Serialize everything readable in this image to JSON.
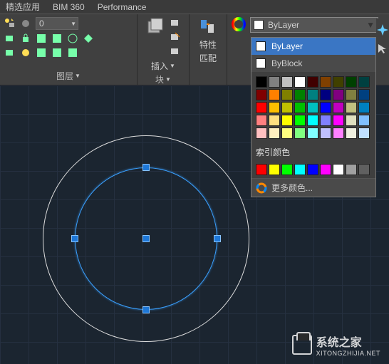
{
  "tabs": {
    "t1": "精选应用",
    "t2": "BIM 360",
    "t3": "Performance"
  },
  "panels": {
    "layers": {
      "label": "图层",
      "dropdown_value": "0"
    },
    "blocks": {
      "label": "块",
      "insert": "插入"
    },
    "props": {
      "label": "特性",
      "match": "匹配"
    }
  },
  "color_selector": {
    "current": "ByLayer"
  },
  "color_dropdown": {
    "bylayer": "ByLayer",
    "byblock": "ByBlock",
    "index_label": "索引颜色",
    "more": "更多颜色...",
    "palette": [
      "#000000",
      "#808080",
      "#c0c0c0",
      "#ffffff",
      "#400000",
      "#804000",
      "#404000",
      "#004000",
      "#004040",
      "#800000",
      "#ff8000",
      "#808000",
      "#008000",
      "#008080",
      "#000080",
      "#800080",
      "#808040",
      "#004080",
      "#ff0000",
      "#ffc000",
      "#c0c000",
      "#00c000",
      "#00c0c0",
      "#0000ff",
      "#c000c0",
      "#c0c080",
      "#0080c0",
      "#ff8080",
      "#ffe080",
      "#ffff00",
      "#00ff00",
      "#00ffff",
      "#8080ff",
      "#ff00ff",
      "#e0e0c0",
      "#80c0ff",
      "#ffc0c0",
      "#fff0c0",
      "#ffff80",
      "#80ff80",
      "#80ffff",
      "#c0c0ff",
      "#ff80ff",
      "#f0f0e0",
      "#c0e0ff"
    ],
    "index_colors": [
      "#ff0000",
      "#ffff00",
      "#00ff00",
      "#00ffff",
      "#0000ff",
      "#ff00ff",
      "#ffffff",
      "#a0a0a0",
      "#606060"
    ]
  },
  "watermark": {
    "title": "系统之家",
    "url": "XITONGZHIJIA.NET"
  }
}
